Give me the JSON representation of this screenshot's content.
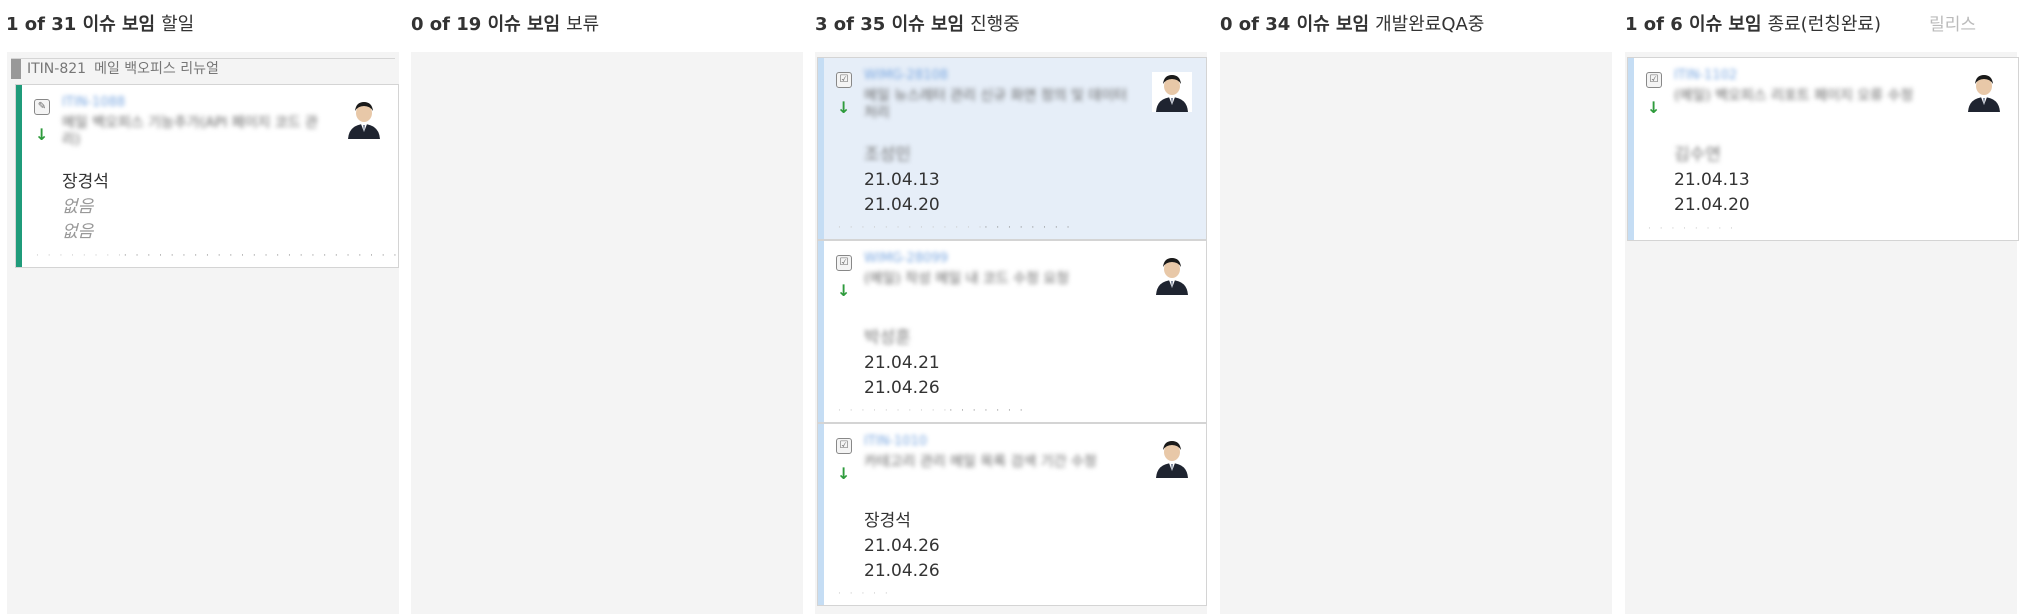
{
  "release_link": "릴리스",
  "columns": [
    {
      "count": "1 of 31 이슈 보임",
      "status": "할일"
    },
    {
      "count": "0 of 19 이슈 보임",
      "status": "보류"
    },
    {
      "count": "3 of 35 이슈 보임",
      "status": "진행중"
    },
    {
      "count": "0 of 34 이슈 보임",
      "status": "개발완료QA중"
    },
    {
      "count": "1 of 6 이슈 보임",
      "status": "종료(런칭완료)"
    }
  ],
  "swimlane": {
    "key": "ITIN-821",
    "title": "메일 백오피스 리뉴얼"
  },
  "cards": {
    "todo": {
      "key": "ITIN-1088",
      "summary": "메일 백오피스 기능추가(API 페이지 코드 관리)",
      "assignee": "장경석",
      "field1": "없음",
      "field2": "없음"
    },
    "prog1": {
      "key": "WIMG-28108",
      "summary": "메일 뉴스레터 관리 신규 화면 정의 및 데이터 처리",
      "assignee": "조성민",
      "date1": "21.04.13",
      "date2": "21.04.20"
    },
    "prog2": {
      "key": "WIMG-28099",
      "summary": "(메일) 작성 메일 내 코드 수정 요청",
      "assignee": "박성훈",
      "date1": "21.04.21",
      "date2": "21.04.26"
    },
    "prog3": {
      "key": "ITIN-1010",
      "summary": "카테고리 관리 메일 목록 검색 기간 수정",
      "assignee": "장경석",
      "date1": "21.04.26",
      "date2": "21.04.26"
    },
    "done": {
      "key": "ITIN-1102",
      "summary": "(메일) 백오피스 리포트 페이지 오류 수정",
      "assignee": "김수연",
      "date1": "21.04.13",
      "date2": "21.04.20"
    }
  },
  "colors": {
    "bar_todo": "#1f9b7a",
    "bar_prog": "#c5ddf4",
    "accent_key": "#7aa7e0",
    "priority_low": "#2e9b3c"
  }
}
